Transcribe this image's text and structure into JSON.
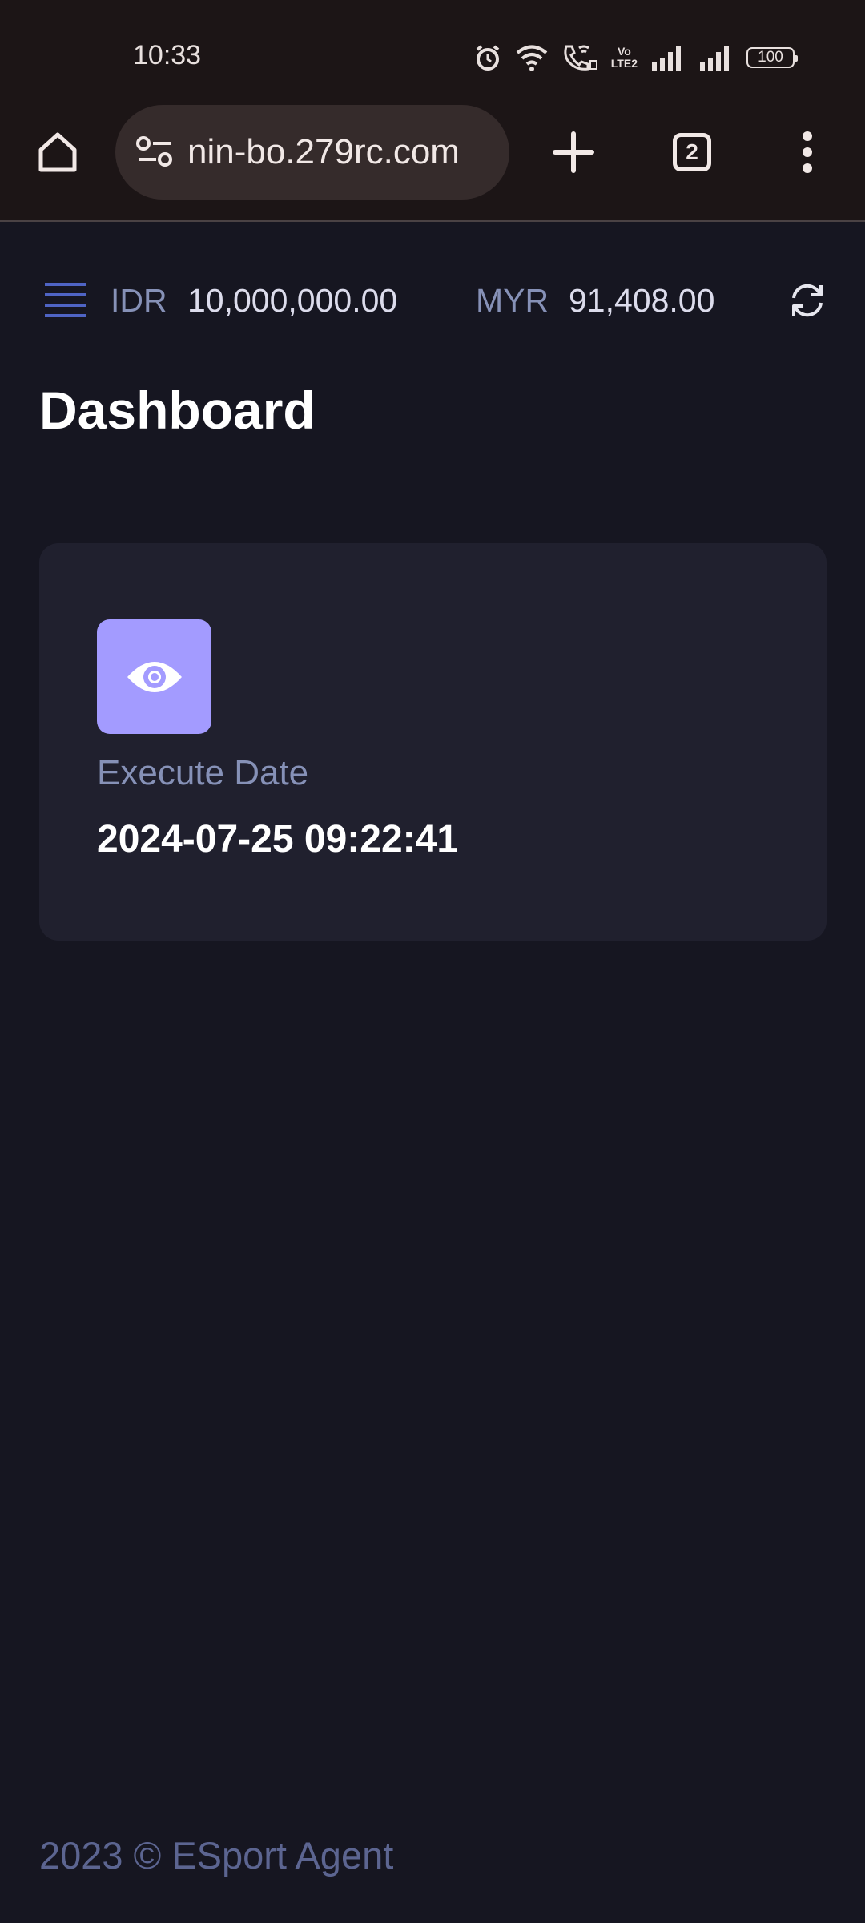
{
  "status_bar": {
    "time": "10:33",
    "icons": [
      "alarm-icon",
      "wifi-icon",
      "wifi-calling-icon",
      "volte-icon",
      "signal-icon",
      "signal-icon"
    ],
    "volte_label_top": "Vo",
    "volte_label_bottom": "LTE2",
    "battery": "100"
  },
  "browser": {
    "url": "nin-bo.279rc.com",
    "tab_count": "2"
  },
  "header": {
    "currencies": [
      {
        "code": "IDR",
        "value": "10,000,000.00"
      },
      {
        "code": "MYR",
        "value": "91,408.00"
      }
    ]
  },
  "page": {
    "title": "Dashboard"
  },
  "card": {
    "icon": "eye-icon",
    "label": "Execute Date",
    "value": "2024-07-25 09:22:41"
  },
  "footer": {
    "text": "2023 © ESport Agent"
  },
  "colors": {
    "background": "#161621",
    "card": "#20202e",
    "accent": "#a39bff",
    "menu_icon": "#4f64c4",
    "muted_text": "#8691b7"
  }
}
